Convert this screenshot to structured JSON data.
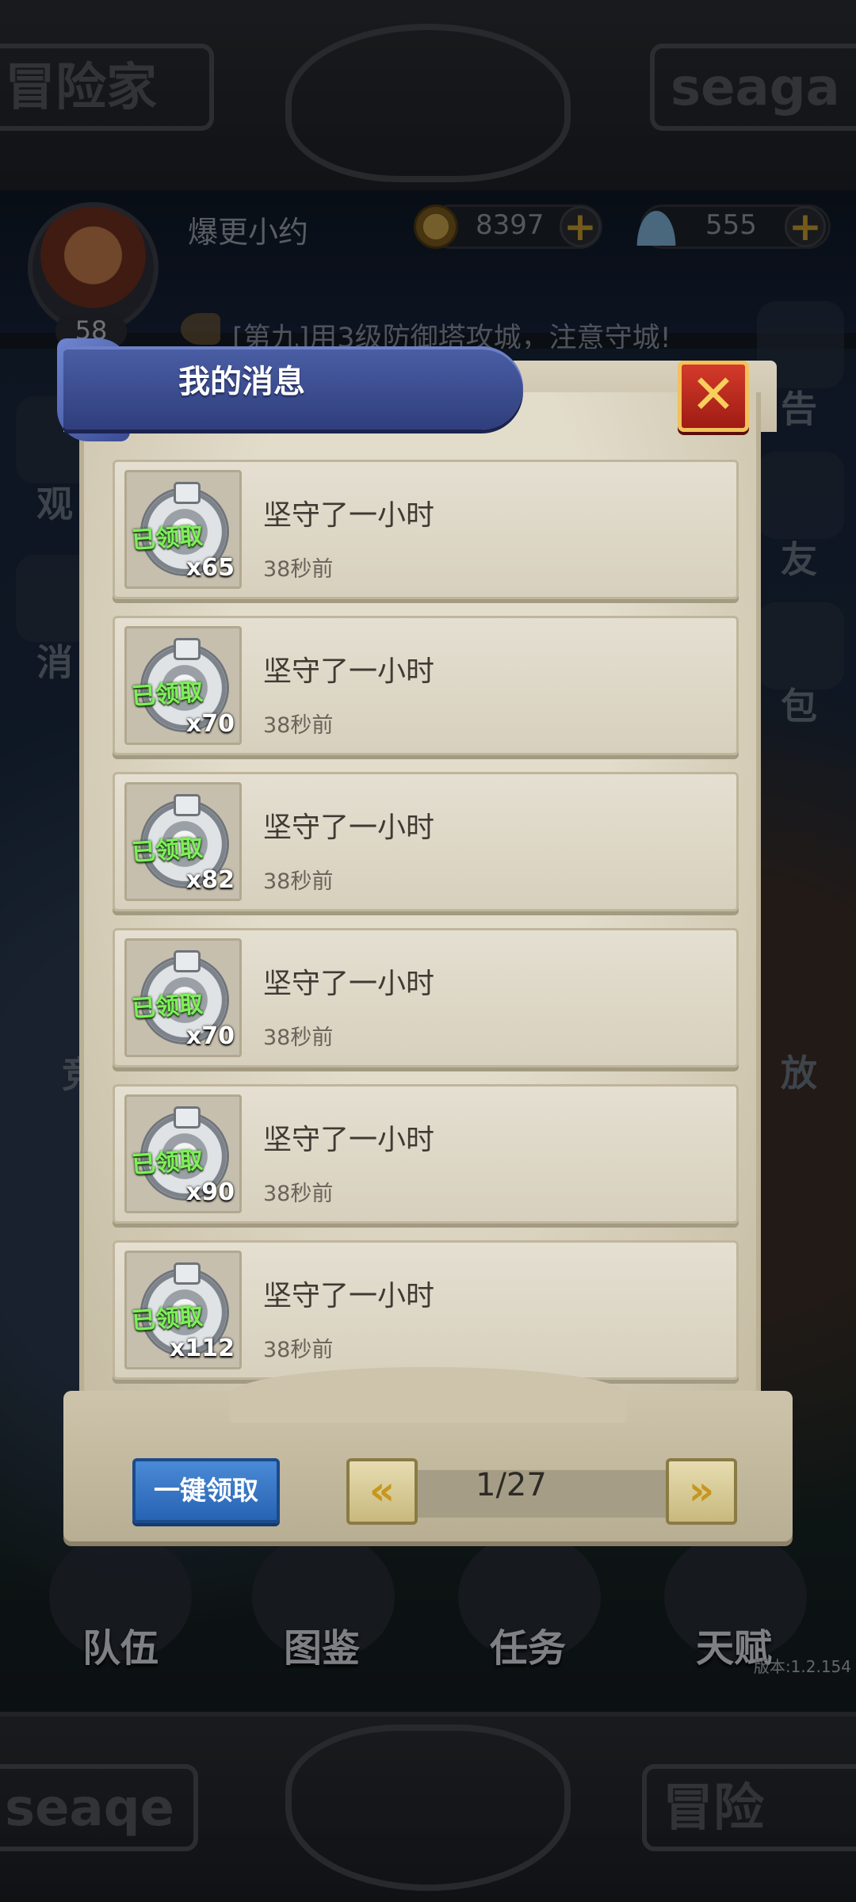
{
  "background": {
    "top_plate_left": "冒险家",
    "top_plate_right": "seaga",
    "bottom_plate_left": "seaqe",
    "bottom_plate_right": "冒险",
    "player": {
      "name": "爆更小约",
      "level": "58"
    },
    "resources": [
      {
        "icon": "coin-icon",
        "value": "8397"
      },
      {
        "icon": "shell-icon",
        "value": "555"
      }
    ],
    "ticker": "[第九]用3级防御塔攻城，注意守城!",
    "side_labels_left": [
      "观",
      "消"
    ],
    "side_labels_right": [
      "告",
      "友",
      "包",
      "放"
    ],
    "side_label_left_lower": "竞",
    "bottom_nav": [
      "队伍",
      "图鉴",
      "任务",
      "天赋"
    ],
    "version": "版本:1.2.154"
  },
  "dialog": {
    "title": "我的消息",
    "close_icon": "close-x-icon",
    "messages": [
      {
        "title": "坚守了一小时",
        "time": "38秒前",
        "status": "已领取",
        "qty": "x65"
      },
      {
        "title": "坚守了一小时",
        "time": "38秒前",
        "status": "已领取",
        "qty": "x70"
      },
      {
        "title": "坚守了一小时",
        "time": "38秒前",
        "status": "已领取",
        "qty": "x82"
      },
      {
        "title": "坚守了一小时",
        "time": "38秒前",
        "status": "已领取",
        "qty": "x70"
      },
      {
        "title": "坚守了一小时",
        "time": "38秒前",
        "status": "已领取",
        "qty": "x90"
      },
      {
        "title": "坚守了一小时",
        "time": "38秒前",
        "status": "已领取",
        "qty": "x112"
      }
    ],
    "footer": {
      "claim_all": "一键领取",
      "prev_icon": "double-chevron-left-icon",
      "next_icon": "double-chevron-right-icon",
      "page": "1/27"
    }
  },
  "colors": {
    "banner": "#3a4b94",
    "claimed_text": "#7ef05a",
    "claim_all_button": "#2763b3",
    "close_button": "#c0281c"
  }
}
